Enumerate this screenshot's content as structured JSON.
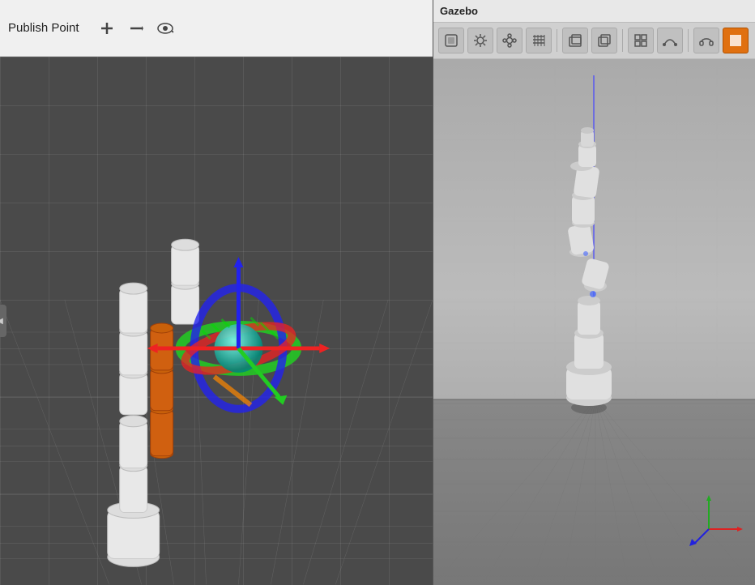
{
  "left_panel": {
    "toolbar": {
      "title": "Publish Point",
      "add_btn": "+",
      "remove_btn": "−",
      "settings_btn": "⊕"
    }
  },
  "right_panel": {
    "title": "Gazebo",
    "toolbar_buttons": [
      {
        "id": "select",
        "icon": "▢",
        "active": false
      },
      {
        "id": "translate",
        "icon": "✲",
        "active": false
      },
      {
        "id": "rotate",
        "icon": "↻",
        "active": false
      },
      {
        "id": "lines",
        "icon": "⋰",
        "active": false
      },
      {
        "id": "sep1",
        "separator": true
      },
      {
        "id": "box",
        "icon": "▭",
        "active": false
      },
      {
        "id": "copy",
        "icon": "⧉",
        "active": false
      },
      {
        "id": "sep2",
        "separator": true
      },
      {
        "id": "grid",
        "icon": "▤",
        "active": false
      },
      {
        "id": "curve",
        "icon": "⌒",
        "active": false
      },
      {
        "id": "sep3",
        "separator": true
      },
      {
        "id": "headphones",
        "icon": "◡",
        "active": false
      },
      {
        "id": "orange",
        "icon": "■",
        "active": true
      }
    ]
  },
  "colors": {
    "toolbar_bg": "#f0f0f0",
    "left_viewport_bg": "#4a4a4a",
    "right_viewport_bg": "#888888",
    "gazebo_toolbar_bg": "#d0d0d0",
    "active_btn": "#e07010"
  }
}
